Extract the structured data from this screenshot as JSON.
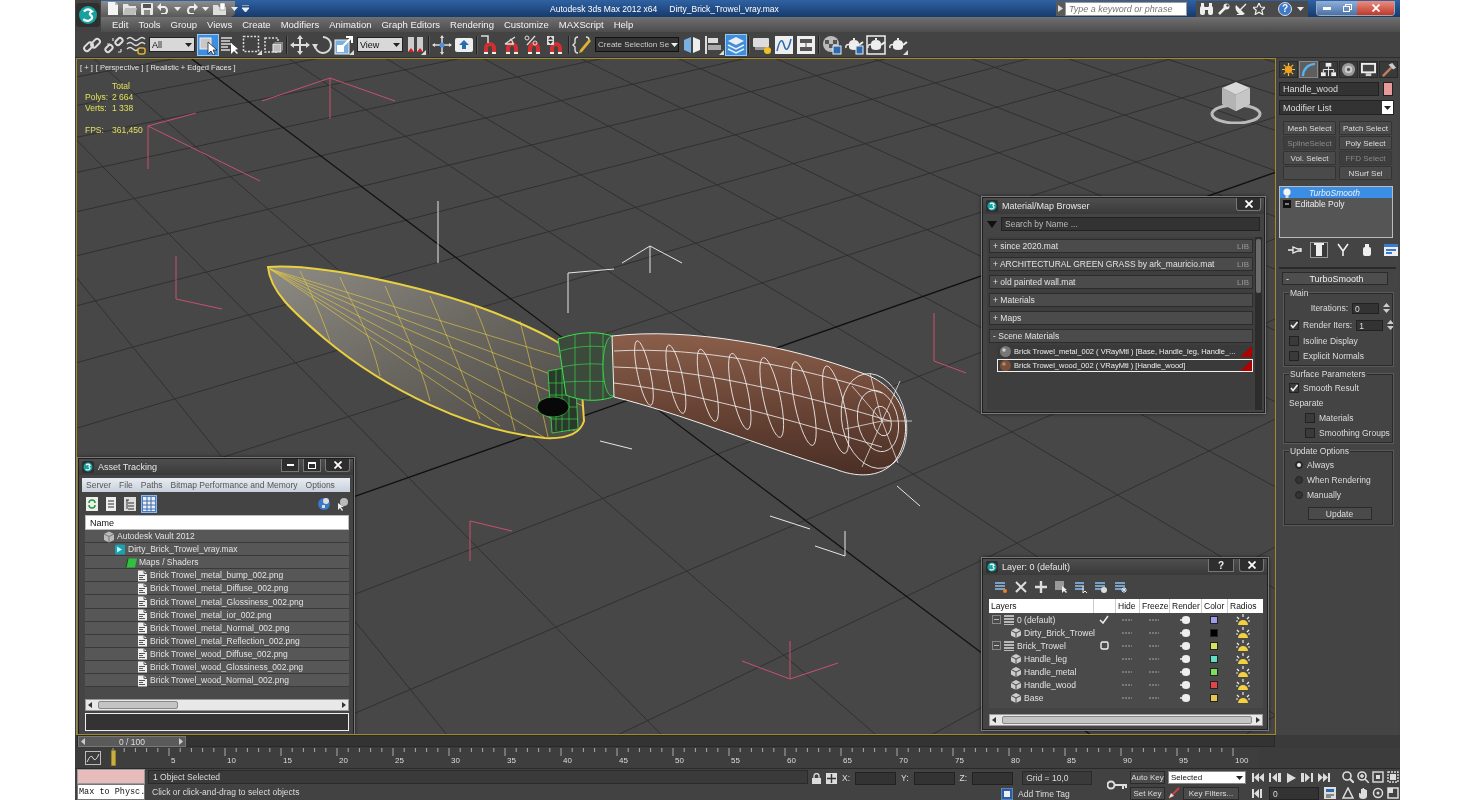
{
  "title_bar": {
    "app": "Autodesk 3ds Max 2012 x64",
    "document": "Dirty_Brick_Trowel_vray.max",
    "search": {
      "placeholder": "Type a keyword or phrase"
    },
    "help": "?"
  },
  "menu_bar": [
    "Edit",
    "Tools",
    "Group",
    "Views",
    "Create",
    "Modifiers",
    "Animation",
    "Graph Editors",
    "Rendering",
    "Customize",
    "MAXScript",
    "Help"
  ],
  "main_toolbar": [
    {
      "kind": "link",
      "selected": false
    },
    {
      "kind": "unlink",
      "selected": false
    },
    {
      "kind": "bind",
      "selected": false
    },
    {
      "kind": "dropdown",
      "value": "All"
    },
    {
      "kind": "select",
      "selected": true
    },
    {
      "kind": "select_by_name",
      "selected": false
    },
    {
      "kind": "region",
      "selected": false
    },
    {
      "kind": "crossing",
      "selected": false
    },
    {
      "kind": "move",
      "selected": false
    },
    {
      "kind": "rotate",
      "selected": false
    },
    {
      "kind": "scale",
      "selected": false
    },
    {
      "kind": "dropdown",
      "value": "View"
    },
    {
      "kind": "pivot",
      "selected": false
    },
    {
      "kind": "manipulate",
      "selected": false
    },
    {
      "kind": "shortcut",
      "selected": false
    },
    {
      "kind": "snap",
      "selected": false
    },
    {
      "kind": "angle_snap",
      "selected": false
    },
    {
      "kind": "percent_snap",
      "selected": false
    },
    {
      "kind": "spinner_snap",
      "selected": false
    },
    {
      "kind": "named_sets",
      "selected": false
    },
    {
      "kind": "dark_dropdown",
      "value": "Create Selection Se"
    },
    {
      "kind": "mirror",
      "selected": false
    },
    {
      "kind": "align",
      "selected": false
    },
    {
      "kind": "layers",
      "selected": true
    },
    {
      "kind": "ribbon",
      "selected": false
    },
    {
      "kind": "curve_editor",
      "selected": false
    },
    {
      "kind": "schematic",
      "selected": false
    },
    {
      "kind": "material_editor",
      "selected": false
    },
    {
      "kind": "render_setup",
      "selected": false
    },
    {
      "kind": "frame_window",
      "selected": false
    },
    {
      "kind": "render",
      "selected": false
    }
  ],
  "viewport": {
    "menus": [
      "[ + ]",
      "[ Perspective ]",
      "[ Realistic + Edged Faces ]"
    ],
    "stats": {
      "heading": "Total",
      "rows": [
        {
          "label": "Polys:",
          "value": "2 664"
        },
        {
          "label": "Verts:",
          "value": "1 338"
        }
      ],
      "fps": {
        "label": "FPS:",
        "value": "361,450"
      }
    }
  },
  "material_browser": {
    "title": "Material/Map Browser",
    "search": {
      "placeholder": "Search by Name ..."
    },
    "groups": [
      {
        "sign": "+",
        "label": "since 2020.mat",
        "tag": "LIB"
      },
      {
        "sign": "+",
        "label": "ARCHITECTURAL GREEN GRASS by ark_mauricio.mat",
        "tag": "LIB"
      },
      {
        "sign": "+",
        "label": "old painted wall.mat",
        "tag": "LIB"
      },
      {
        "sign": "+",
        "label": "Materials"
      },
      {
        "sign": "+",
        "label": "Maps"
      },
      {
        "sign": "-",
        "label": "Scene Materials",
        "items": [
          {
            "kind": "metal",
            "label": "Brick Trowel_metal_002 ( VRayMtl ) [Base, Handle_leg, Handle_...",
            "selected": false
          },
          {
            "kind": "wood",
            "label": "Brick Trowel_wood_002 ( VRayMtl ) [Handle_wood]",
            "selected": true
          }
        ]
      }
    ]
  },
  "asset_tracking": {
    "title": "Asset Tracking",
    "menu": [
      "Server",
      "File",
      "Paths",
      "Bitmap Performance and Memory",
      "Options"
    ],
    "tools": [
      {
        "kind": "refresh",
        "selected": false
      },
      {
        "kind": "list",
        "selected": false
      },
      {
        "kind": "tree",
        "selected": false
      },
      {
        "kind": "table",
        "selected": true
      }
    ],
    "column": "Name",
    "tree": [
      {
        "kind": "vault",
        "label": "Autodesk Vault 2012",
        "children": [
          {
            "kind": "scene",
            "label": "Dirty_Brick_Trowel_vray.max",
            "children": [
              {
                "kind": "folder",
                "label": "Maps / Shaders",
                "children": [
                  {
                    "kind": "bitmap",
                    "label": "Brick Trowel_metal_bump_002.png"
                  },
                  {
                    "kind": "bitmap",
                    "label": "Brick Trowel_metal_Diffuse_002.png"
                  },
                  {
                    "kind": "bitmap",
                    "label": "Brick Trowel_metal_Glossiness_002.png"
                  },
                  {
                    "kind": "bitmap",
                    "label": "Brick Trowel_metal_ior_002.png"
                  },
                  {
                    "kind": "bitmap",
                    "label": "Brick Trowel_metal_Normal_002.png"
                  },
                  {
                    "kind": "bitmap",
                    "label": "Brick Trowel_metal_Reflection_002.png"
                  },
                  {
                    "kind": "bitmap",
                    "label": "Brick Trowel_wood_Diffuse_002.png"
                  },
                  {
                    "kind": "bitmap",
                    "label": "Brick Trowel_wood_Glossiness_002.png"
                  },
                  {
                    "kind": "bitmap",
                    "label": "Brick Trowel_wood_Normal_002.png"
                  }
                ]
              }
            ]
          }
        ]
      }
    ]
  },
  "layer_manager": {
    "title": "Layer: 0 (default)",
    "help": "?",
    "columns": [
      "Layers",
      "Hide",
      "Freeze",
      "Render",
      "Color",
      "Radios"
    ],
    "layers": [
      {
        "name": "0 (default)",
        "current": true,
        "expanded": true,
        "color": "#9c9cee",
        "children": [
          {
            "name": "Dirty_Brick_Trowel",
            "color": "#000000"
          }
        ]
      },
      {
        "name": "Brick_Trowel",
        "current": false,
        "expanded": true,
        "color": "#d6e25c",
        "children": [
          {
            "name": "Handle_leg",
            "color": "#5ee0c4"
          },
          {
            "name": "Handle_metal",
            "color": "#7ade58"
          },
          {
            "name": "Handle_wood",
            "color": "#e04646"
          },
          {
            "name": "Base",
            "color": "#e6c44e"
          }
        ]
      }
    ]
  },
  "command_panel": {
    "tabs": [
      {
        "kind": "create",
        "selected": false
      },
      {
        "kind": "modify",
        "selected": true
      },
      {
        "kind": "hierarchy",
        "selected": false
      },
      {
        "kind": "motion",
        "selected": false
      },
      {
        "kind": "display",
        "selected": false
      },
      {
        "kind": "utilities",
        "selected": false
      }
    ],
    "object_name": "Handle_wood",
    "modifier_list": "Modifier List",
    "modifier_sets": [
      {
        "kind": "button",
        "label": "Mesh Select",
        "disabled": false
      },
      {
        "kind": "button",
        "label": "Patch Select",
        "disabled": false
      },
      {
        "kind": "button",
        "label": "SplineSelect",
        "disabled": true
      },
      {
        "kind": "button",
        "label": "Poly Select",
        "disabled": false
      },
      {
        "kind": "button",
        "label": "Vol. Select",
        "disabled": false
      },
      {
        "kind": "button",
        "label": "FFD Select",
        "disabled": true
      },
      {
        "kind": "blank",
        "disabled": false
      },
      {
        "kind": "button",
        "label": "NSurf Sel",
        "disabled": false
      }
    ],
    "stack": [
      {
        "kind": "modifier",
        "label": "TurboSmooth",
        "selected": true
      },
      {
        "kind": "base",
        "label": "Editable Poly",
        "selected": false
      }
    ],
    "stack_tools": [
      {
        "kind": "pin",
        "on": false
      },
      {
        "kind": "result",
        "on": true
      },
      {
        "kind": "unique",
        "on": false
      },
      {
        "kind": "remove",
        "on": false
      },
      {
        "kind": "configure",
        "on": false
      }
    ],
    "rollout": {
      "sign": "-",
      "title": "TurboSmooth",
      "groups": [
        {
          "title": "Main",
          "controls": [
            {
              "kind": "spinner",
              "label": "Iterations:",
              "value": "0"
            },
            {
              "kind": "check_spinner",
              "label": "Render Iters:",
              "value": "1",
              "checked": true
            },
            {
              "kind": "checkbox",
              "label": "Isoline Display",
              "checked": false
            },
            {
              "kind": "checkbox",
              "label": "Explicit Normals",
              "checked": false
            }
          ]
        },
        {
          "title": "Surface Parameters",
          "controls": [
            {
              "kind": "checkbox",
              "label": "Smooth Result",
              "checked": true
            },
            {
              "kind": "label",
              "label": "Separate"
            },
            {
              "kind": "subcheckbox",
              "label": "Materials",
              "checked": false
            },
            {
              "kind": "subcheckbox",
              "label": "Smoothing Groups",
              "checked": false
            }
          ]
        },
        {
          "title": "Update Options",
          "controls": [
            {
              "kind": "radio",
              "label": "Always",
              "selected": true
            },
            {
              "kind": "radio",
              "label": "When Rendering",
              "selected": false
            },
            {
              "kind": "radio",
              "label": "Manually",
              "selected": false
            },
            {
              "kind": "button",
              "label": "Update"
            }
          ]
        }
      ]
    }
  },
  "timeline": {
    "position": "0 / 100",
    "level": 0,
    "ticks": [
      "5",
      "10",
      "15",
      "20",
      "25",
      "30",
      "35",
      "40",
      "45",
      "50",
      "55",
      "60",
      "65",
      "70",
      "75",
      "80",
      "85",
      "90",
      "95",
      "100"
    ]
  },
  "status_bar": {
    "listener": "Max to Physc.",
    "selection": "1 Object Selected",
    "prompt": "Click or click-and-drag to select objects",
    "coords": [
      "X:",
      "Y:",
      "Z:"
    ],
    "grid": "Grid = 10,0",
    "time_tag": "Add Time Tag",
    "auto_key": "Auto Key",
    "key_mode": "Selected",
    "set_key": "Set Key",
    "key_filters": "Key Filters...",
    "frame": "0"
  }
}
